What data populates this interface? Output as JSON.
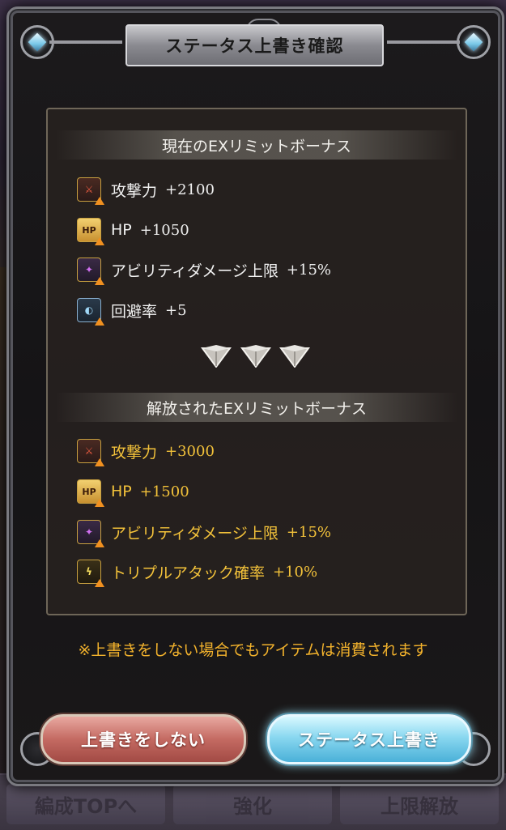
{
  "dialog": {
    "title": "ステータス上書き確認",
    "current_section_title": "現在のEXリミットボーナス",
    "released_section_title": "解放されたEXリミットボーナス",
    "notice": "※上書きをしない場合でもアイテムは消費されます",
    "cancel_label": "上書きをしない",
    "confirm_label": "ステータス上書き"
  },
  "current_bonuses": [
    {
      "name": "攻撃力",
      "value": "+2100",
      "icon": "attack-icon"
    },
    {
      "name": "HP",
      "value": "+1050",
      "icon": "hp-icon"
    },
    {
      "name": "アビリティダメージ上限",
      "value": "+15%",
      "icon": "ability-damage-icon"
    },
    {
      "name": "回避率",
      "value": "+5",
      "icon": "evasion-icon"
    }
  ],
  "released_bonuses": [
    {
      "name": "攻撃力",
      "value": "+3000",
      "icon": "attack-icon"
    },
    {
      "name": "HP",
      "value": "+1500",
      "icon": "hp-icon"
    },
    {
      "name": "アビリティダメージ上限",
      "value": "+15%",
      "icon": "ability-damage-icon"
    },
    {
      "name": "トリプルアタック確率",
      "value": "+10%",
      "icon": "triple-attack-icon"
    }
  ],
  "background": {
    "nav_left": "編成TOPへ",
    "nav_mid": "強化",
    "nav_right": "上限解放"
  },
  "colors": {
    "highlight": "#f3c23a",
    "notice": "#f2b22c",
    "cancel_button": "#c46a62",
    "confirm_button": "#8ad8f0"
  }
}
